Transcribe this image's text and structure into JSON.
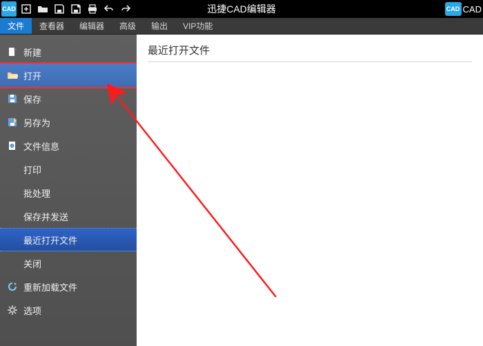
{
  "titlebar": {
    "app_icon_text": "CAD",
    "title": "迅捷CAD编辑器",
    "right_icon_text": "CAD",
    "right_label": "CAD"
  },
  "menubar": {
    "tabs": [
      {
        "label": "文件",
        "active": true
      },
      {
        "label": "查看器"
      },
      {
        "label": "编辑器"
      },
      {
        "label": "高级"
      },
      {
        "label": "输出"
      },
      {
        "label": "VIP功能"
      }
    ]
  },
  "sidebar": {
    "items": [
      {
        "label": "新建",
        "icon": "file-new-icon"
      },
      {
        "label": "打开",
        "icon": "folder-open-icon",
        "selected": true,
        "highlighted": true
      },
      {
        "label": "保存",
        "icon": "save-icon"
      },
      {
        "label": "另存为",
        "icon": "save-as-icon"
      },
      {
        "label": "文件信息",
        "icon": "file-info-icon"
      },
      {
        "label": "打印"
      },
      {
        "label": "批处理"
      },
      {
        "label": "保存并发送"
      },
      {
        "label": "最近打开文件",
        "recent": true
      },
      {
        "label": "关闭"
      },
      {
        "label": "重新加载文件",
        "icon": "reload-icon"
      },
      {
        "label": "选项",
        "icon": "gear-icon"
      }
    ]
  },
  "content": {
    "heading": "最近打开文件"
  }
}
